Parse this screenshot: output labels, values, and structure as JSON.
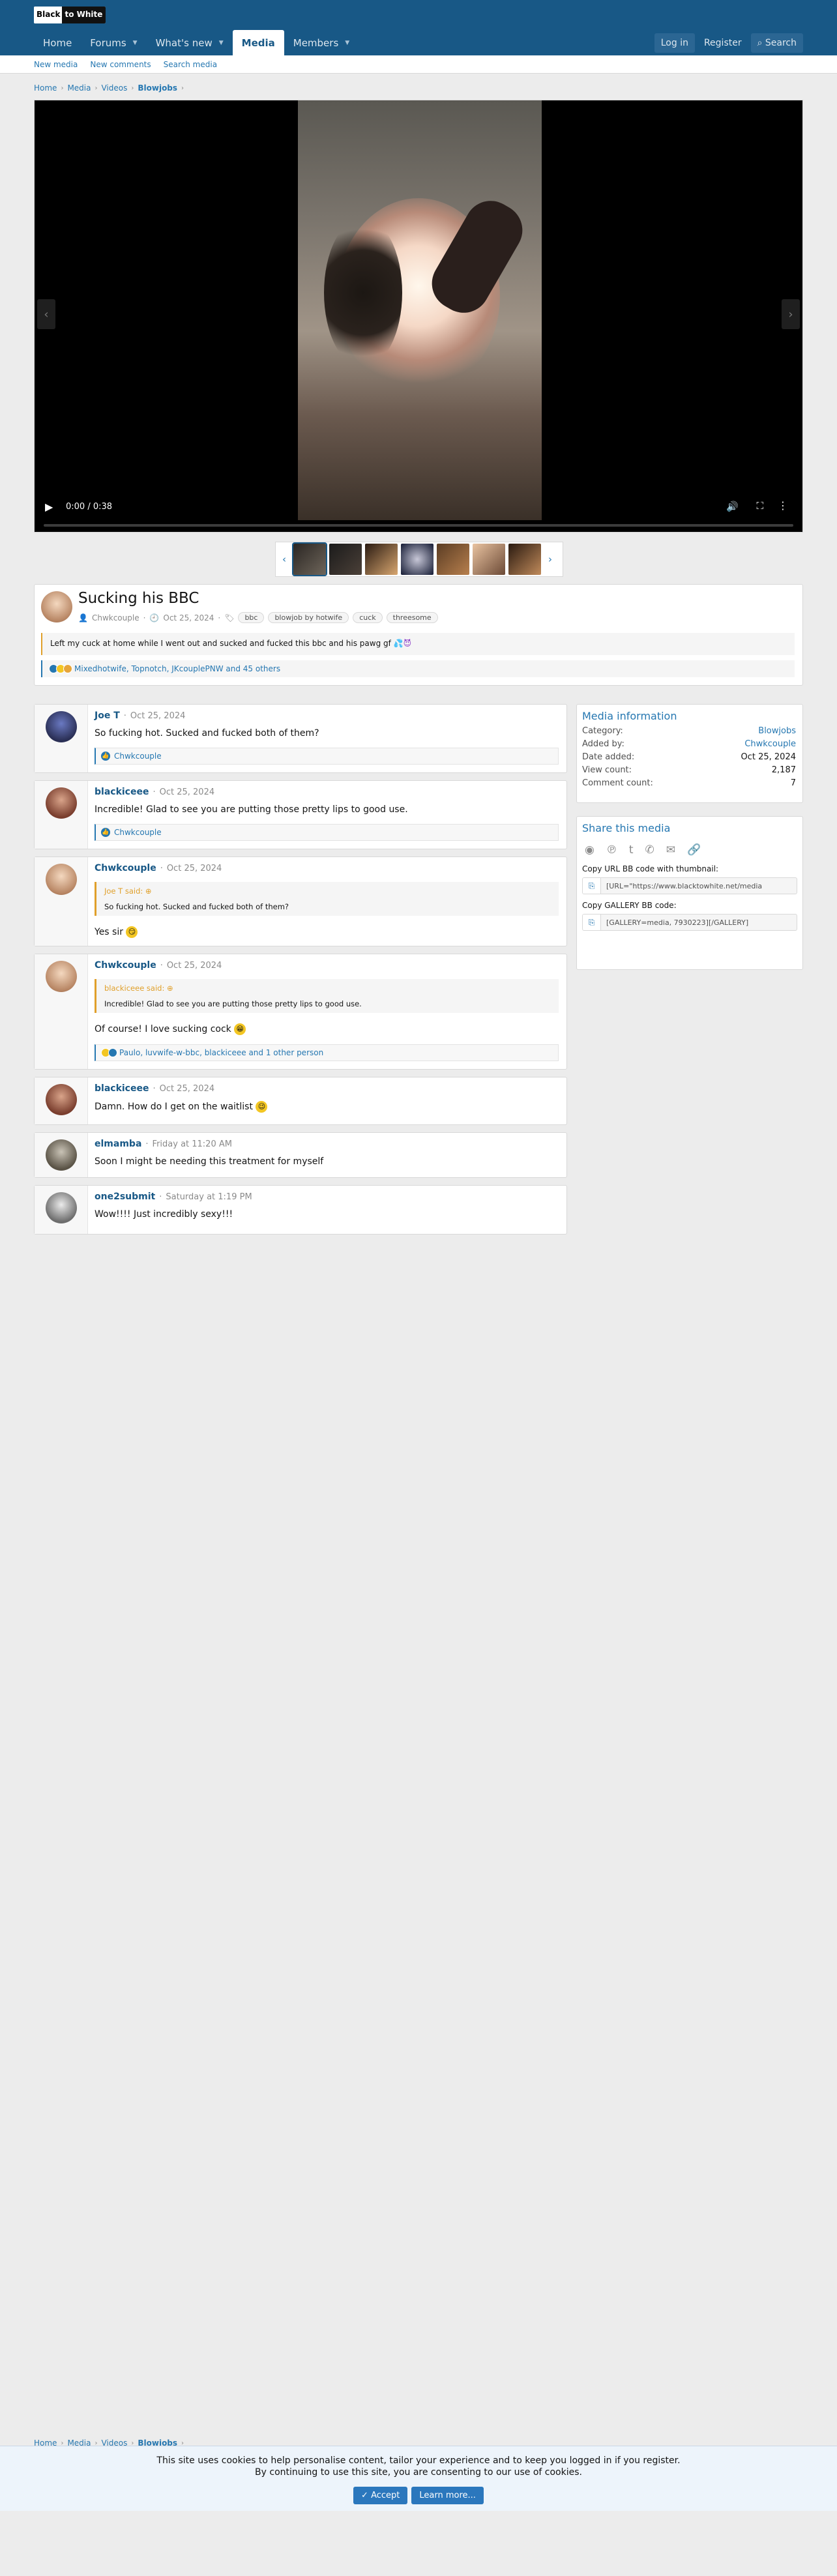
{
  "header": {
    "logo_black": "Black",
    "logo_white": "to White"
  },
  "nav": {
    "items": [
      "Home",
      "Forums",
      "What's new",
      "Media",
      "Members"
    ],
    "login": "Log in",
    "register": "Register",
    "search": "Search"
  },
  "subnav": [
    "New media",
    "New comments",
    "Search media"
  ],
  "breadcrumb": [
    "Home",
    "Media",
    "Videos",
    "Blowjobs"
  ],
  "player": {
    "time": "0:00 / 0:38"
  },
  "media": {
    "title": "Sucking his BBC",
    "author": "Chwkcouple",
    "date": "Oct 25, 2024",
    "tags": [
      "bbc",
      "blowjob by hotwife",
      "cuck",
      "threesome"
    ],
    "description": "Left my cuck at home while I went out and sucked and fucked this bbc and his pawg gf",
    "reactions": "Mixedhotwife, Topnotch, JKcouplePNW and 45 others"
  },
  "comments": [
    {
      "user": "Joe T",
      "date": "Oct 25, 2024",
      "body": "So fucking hot. Sucked and fucked both of them?",
      "likes": "Chwkcouple"
    },
    {
      "user": "blackiceee",
      "date": "Oct 25, 2024",
      "body": "Incredible! Glad to see you are putting those pretty lips to good use.",
      "likes": "Chwkcouple"
    },
    {
      "user": "Chwkcouple",
      "date": "Oct 25, 2024",
      "quote_head": "Joe T said:",
      "quote": "So fucking hot. Sucked and fucked both of them?",
      "body": "Yes sir"
    },
    {
      "user": "Chwkcouple",
      "date": "Oct 25, 2024",
      "quote_head": "blackiceee said:",
      "quote": "Incredible! Glad to see you are putting those pretty lips to good use.",
      "body": "Of course! I love sucking cock",
      "likes": "Paulo, luvwife-w-bbc, blackiceee and 1 other person"
    },
    {
      "user": "blackiceee",
      "date": "Oct 25, 2024",
      "body": "Damn. How do I get on the waitlist"
    },
    {
      "user": "elmamba",
      "date": "Friday at 11:20 AM",
      "body": "Soon I might be needing this treatment for myself"
    },
    {
      "user": "one2submit",
      "date": "Saturday at 1:19 PM",
      "body": "Wow!!!! Just incredibly sexy!!!"
    }
  ],
  "info": {
    "heading": "Media information",
    "rows": [
      [
        "Category:",
        "Blowjobs"
      ],
      [
        "Added by:",
        "Chwkcouple"
      ],
      [
        "Date added:",
        "Oct 25, 2024"
      ],
      [
        "View count:",
        "2,187"
      ],
      [
        "Comment count:",
        "7"
      ]
    ]
  },
  "share": {
    "heading": "Share this media",
    "url_label": "Copy URL BB code with thumbnail:",
    "url_value": "[URL=\"https://www.blacktowhite.net/media",
    "gallery_label": "Copy GALLERY BB code:",
    "gallery_value": "[GALLERY=media, 7930223][/GALLERY]"
  },
  "cookie": {
    "line1": "This site uses cookies to help personalise content, tailor your experience and to keep you logged in if you register.",
    "line2": "By continuing to use this site, you are consenting to our use of cookies.",
    "accept": "Accept",
    "learn": "Learn more..."
  }
}
